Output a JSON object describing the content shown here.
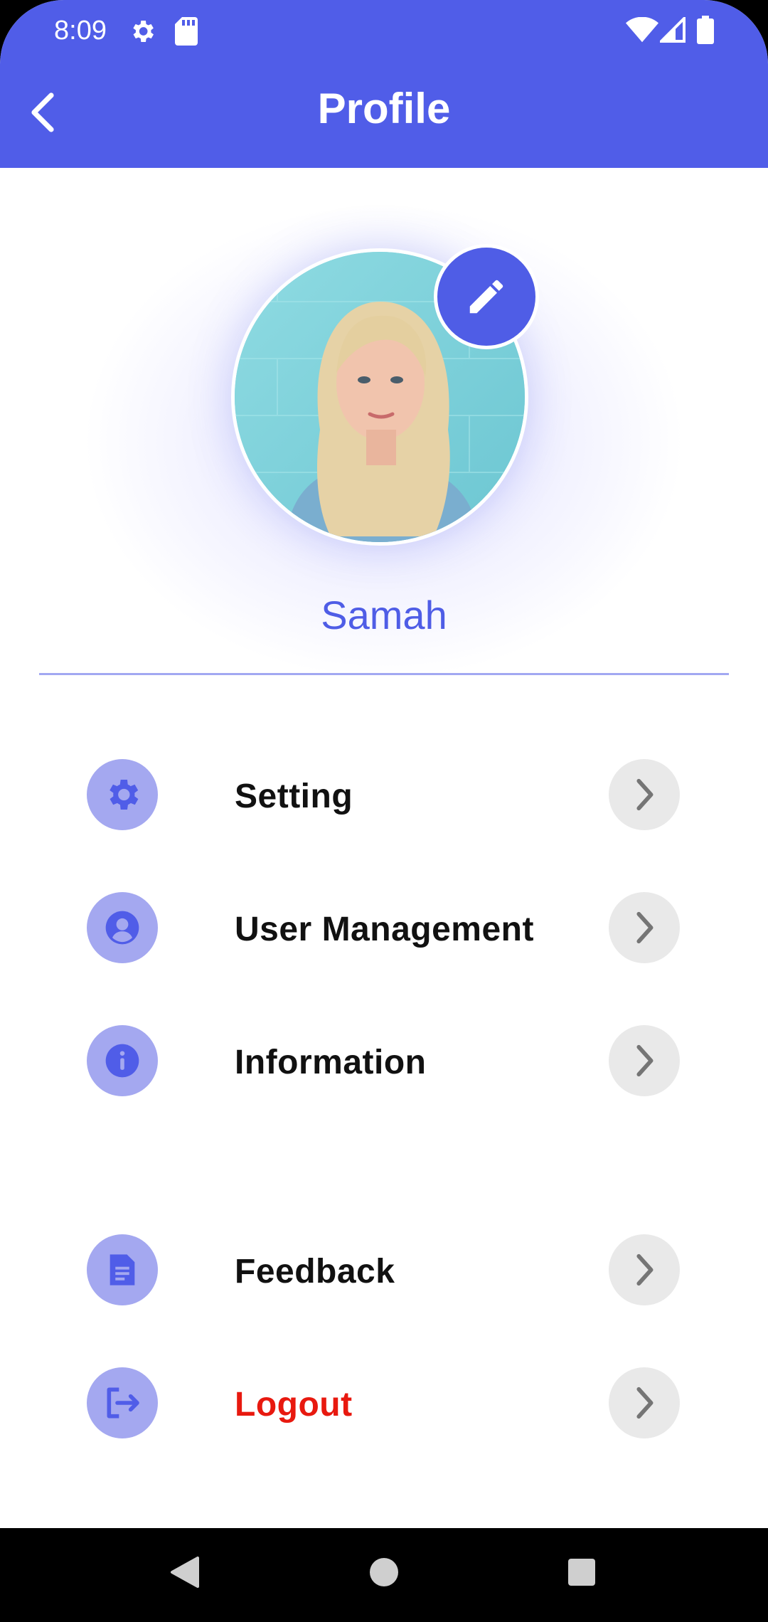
{
  "status_bar": {
    "time": "8:09",
    "icons": [
      "settings-icon",
      "sd-card-icon",
      "wifi-icon",
      "signal-icon",
      "battery-icon"
    ]
  },
  "app_bar": {
    "title": "Profile",
    "back_icon": "back-arrow-icon"
  },
  "profile": {
    "name": "Samah",
    "edit_icon": "pencil-icon"
  },
  "menu": {
    "items": [
      {
        "label": "Setting",
        "icon": "gear-icon"
      },
      {
        "label": "User Management",
        "icon": "account-icon"
      },
      {
        "label": "Information",
        "icon": "info-icon"
      },
      {
        "label": "Feedback",
        "icon": "document-icon"
      },
      {
        "label": "Logout",
        "icon": "logout-icon"
      }
    ]
  },
  "colors": {
    "primary": "#505de8",
    "icon_circle": "#a4a8f0",
    "logout_text": "#e8190f",
    "chevron_bg": "#e9e9e9"
  },
  "nav_bar": {
    "buttons": [
      "back-triangle-icon",
      "home-circle-icon",
      "recents-square-icon"
    ]
  }
}
